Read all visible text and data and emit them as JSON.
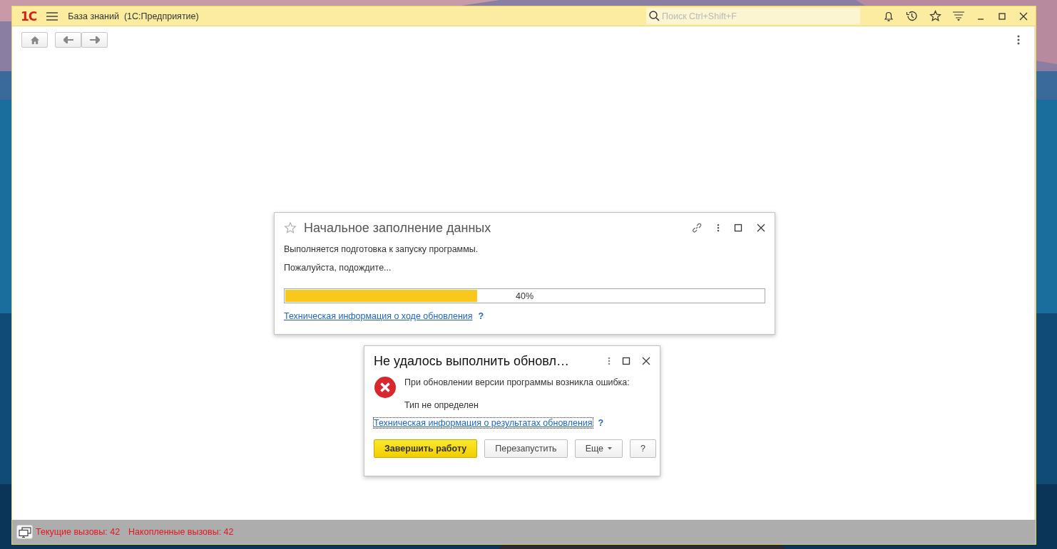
{
  "window": {
    "logo": "1С",
    "title": "База знаний  (1С:Предприятие)",
    "search": {
      "placeholder": "Поиск Ctrl+Shift+F"
    }
  },
  "progress_dialog": {
    "title": "Начальное заполнение данных",
    "lines": [
      "Выполняется подготовка к запуску программы.",
      "Пожалуйста, подождите..."
    ],
    "progress": {
      "level": 0.4,
      "reading": "40%"
    },
    "link": "Техническая информация о ходе обновления",
    "help": "?"
  },
  "error_dialog": {
    "title": "Не удалось выполнить обновл…",
    "message": "При обновлении версии программы возникла ошибка:",
    "detail": "Тип не определен",
    "link": "Техническая информация о результатах обновления",
    "help": "?",
    "buttons": [
      {
        "label": "Завершить работу",
        "kind": "default"
      },
      {
        "label": "Перезапустить",
        "kind": "normal"
      },
      {
        "label": "Еще",
        "kind": "menu"
      },
      {
        "label": "?",
        "kind": "normal"
      }
    ]
  },
  "status_bar": {
    "items": [
      "Текущие вызовы: 42",
      "Накопленные вызовы: 42"
    ]
  }
}
